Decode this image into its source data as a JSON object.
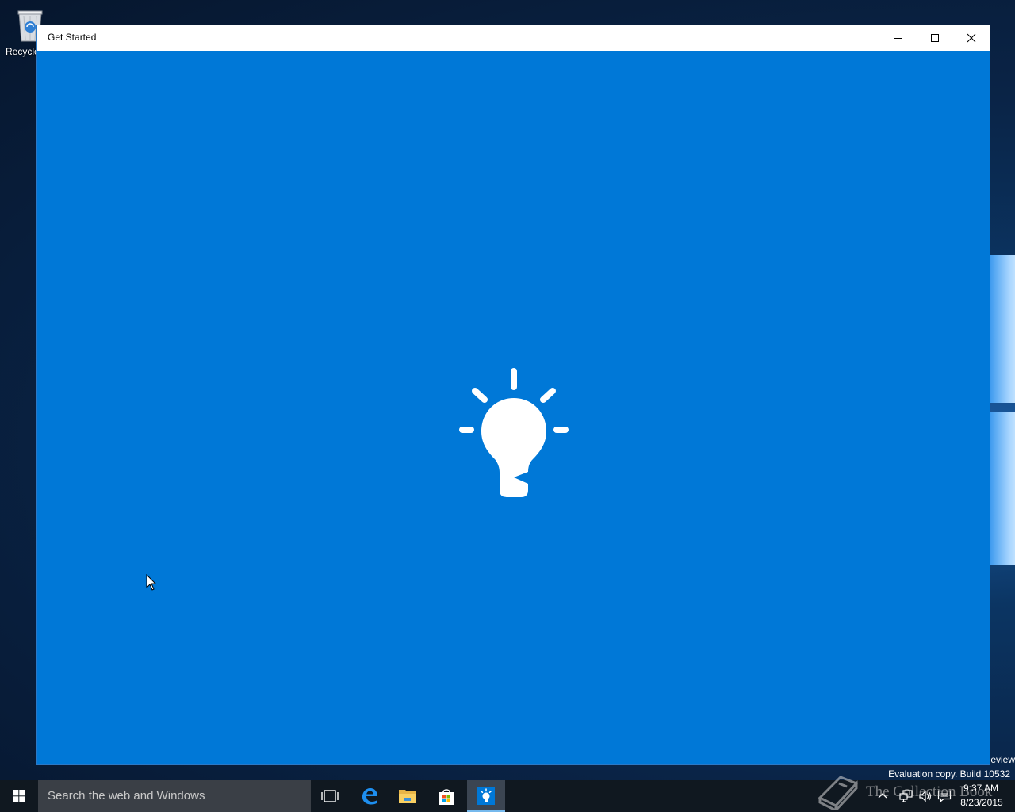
{
  "desktop": {
    "recycle_bin_label": "Recycle"
  },
  "window": {
    "title": "Get Started",
    "controls": {
      "minimize": "minimize-icon",
      "maximize": "maximize-icon",
      "close": "close-icon"
    },
    "content_icon": "lightbulb-icon",
    "accent_color": "#0078d7"
  },
  "watermark": {
    "edition_fragment": "eview",
    "build_text": "Evaluation copy. Build 10532"
  },
  "overlay": {
    "text": "The Collection Book"
  },
  "taskbar": {
    "search_placeholder": "Search the web and Windows",
    "pinned": [
      {
        "name": "task-view",
        "icon": "task-view-icon"
      },
      {
        "name": "edge",
        "icon": "edge-icon"
      },
      {
        "name": "file-explorer",
        "icon": "folder-icon"
      },
      {
        "name": "store",
        "icon": "store-icon"
      },
      {
        "name": "get-started",
        "icon": "lightbulb-icon",
        "active": true
      }
    ],
    "tray": {
      "time": "9:37 AM",
      "date": "8/23/2015"
    }
  }
}
